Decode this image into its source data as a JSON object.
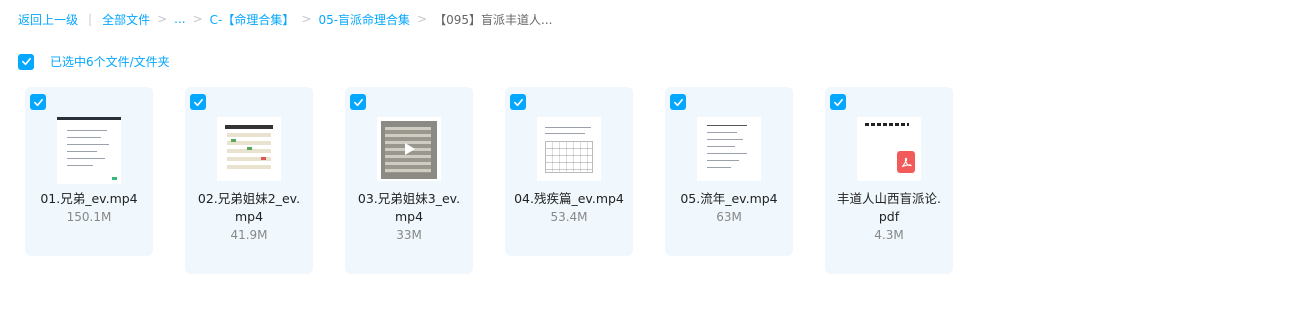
{
  "breadcrumb": {
    "back": "返回上一级",
    "all_files": "全部文件",
    "ellipsis": "...",
    "level1": "C-【命理合集】",
    "level2": "05-盲派命理合集",
    "current": "【095】盲派丰道人..."
  },
  "selection": {
    "label": "已选中6个文件/文件夹"
  },
  "files": [
    {
      "name_line1": "01.兄弟_ev.mp4",
      "name_line2": "",
      "size": "150.1M",
      "type": "video"
    },
    {
      "name_line1": "02.兄弟姐妹2_ev.",
      "name_line2": "mp4",
      "size": "41.9M",
      "type": "video"
    },
    {
      "name_line1": "03.兄弟姐妹3_ev.",
      "name_line2": "mp4",
      "size": "33M",
      "type": "video"
    },
    {
      "name_line1": "04.残疾篇_ev.mp4",
      "name_line2": "",
      "size": "53.4M",
      "type": "video"
    },
    {
      "name_line1": "05.流年_ev.mp4",
      "name_line2": "",
      "size": "63M",
      "type": "video"
    },
    {
      "name_line1": "丰道人山西盲派论.",
      "name_line2": "pdf",
      "size": "4.3M",
      "type": "pdf"
    }
  ],
  "colors": {
    "accent": "#06a7ff",
    "card_bg": "#f0f8fd",
    "pdf_red": "#f35b5b"
  },
  "icons": {
    "checkbox": "check-icon",
    "pdf": "pdf-icon"
  }
}
